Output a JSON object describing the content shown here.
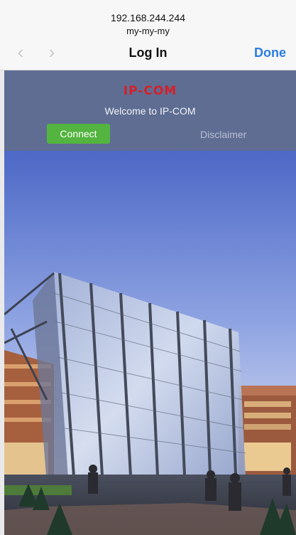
{
  "browser": {
    "url": "192.168.244.244",
    "host_name": "my-my-my",
    "title": "Log In",
    "done_label": "Done",
    "back_icon": "chevron-left-icon",
    "forward_icon": "chevron-right-icon"
  },
  "portal": {
    "logo_text": "IP-COM",
    "welcome_text": "Welcome to IP-COM",
    "connect_label": "Connect",
    "disclaimer_label": "Disclaimer",
    "colors": {
      "header_bg": "#5f6d93",
      "logo": "#d5202a",
      "connect": "#53b43f",
      "accent_link": "#2a7de1"
    }
  }
}
